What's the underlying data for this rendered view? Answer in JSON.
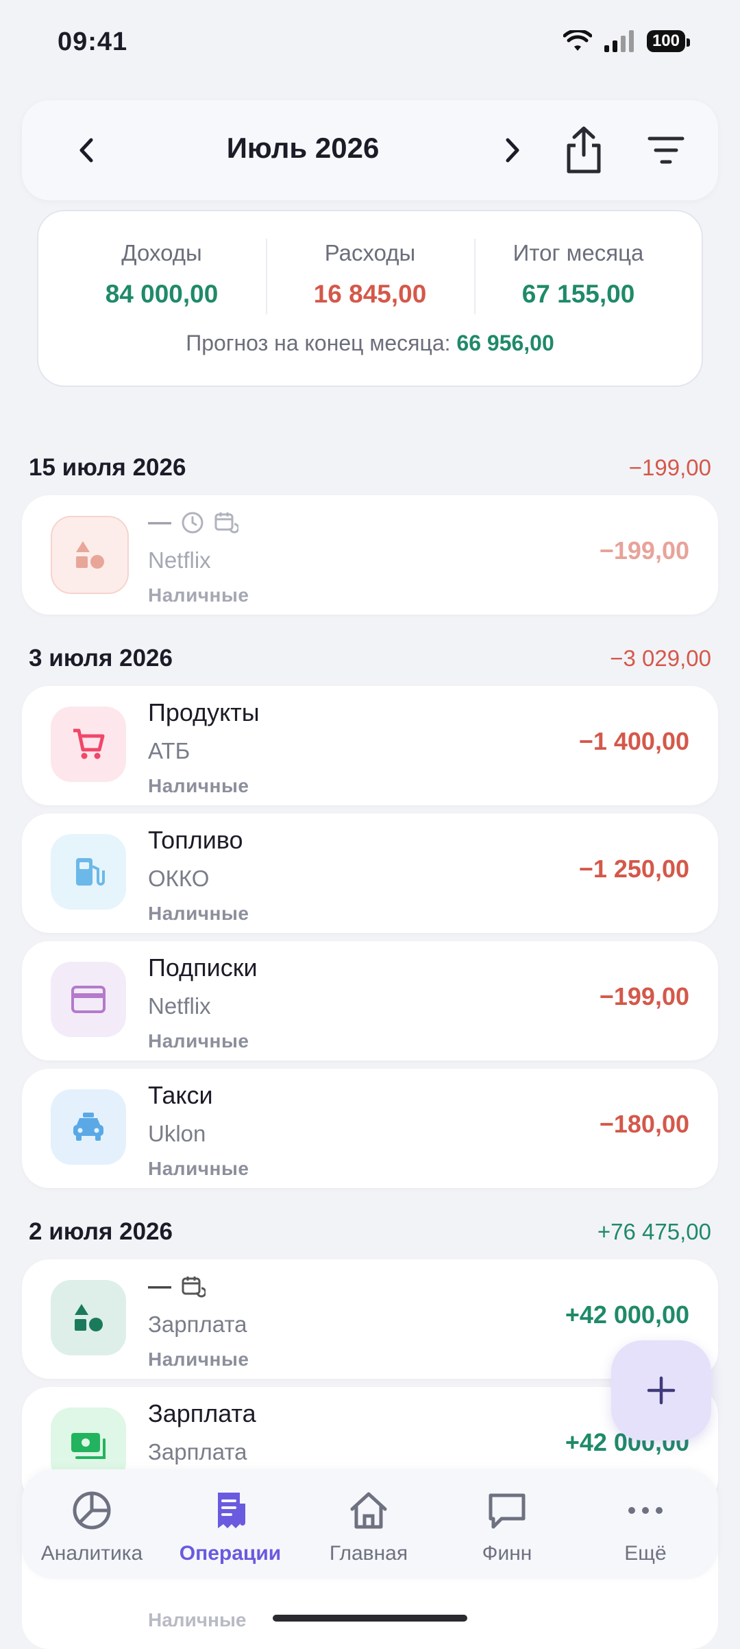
{
  "status_bar": {
    "time": "09:41",
    "battery": "100"
  },
  "header": {
    "month": "Июль 2026"
  },
  "summary": {
    "income_label": "Доходы",
    "income_value": "84 000,00",
    "expense_label": "Расходы",
    "expense_value": "16 845,00",
    "total_label": "Итог месяца",
    "total_value": "67 155,00",
    "forecast_label": "Прогноз на конец месяца:",
    "forecast_value": "66 956,00"
  },
  "groups": [
    {
      "date": "15 июля 2026",
      "sum": "−199,00",
      "items": [
        {
          "name": "—",
          "note": "Netflix",
          "account": "Наличные",
          "amount": "−199,00"
        }
      ]
    },
    {
      "date": "3 июля 2026",
      "sum": "−3 029,00",
      "items": [
        {
          "name": "Продукты",
          "note": "АТБ",
          "account": "Наличные",
          "amount": "−1 400,00"
        },
        {
          "name": "Топливо",
          "note": "ОККО",
          "account": "Наличные",
          "amount": "−1 250,00"
        },
        {
          "name": "Подписки",
          "note": "Netflix",
          "account": "Наличные",
          "amount": "−199,00"
        },
        {
          "name": "Такси",
          "note": "Uklon",
          "account": "Наличные",
          "amount": "−180,00"
        }
      ]
    },
    {
      "date": "2 июля 2026",
      "sum": "+76 475,00",
      "items": [
        {
          "name": "—",
          "note": "Зарплата",
          "account": "Наличные",
          "amount": "+42 000,00"
        },
        {
          "name": "Зарплата",
          "note": "Зарплата",
          "account": "Наличные",
          "amount": "+42 000,00"
        }
      ]
    }
  ],
  "hidden_row": {
    "account": "Наличные"
  },
  "nav": {
    "analytics": "Аналитика",
    "operations": "Операции",
    "home": "Главная",
    "finn": "Финн",
    "more": "Ещё"
  },
  "colors": {
    "accent": "#6A5AE0",
    "income": "#1F8A68",
    "expense": "#D4584A"
  }
}
